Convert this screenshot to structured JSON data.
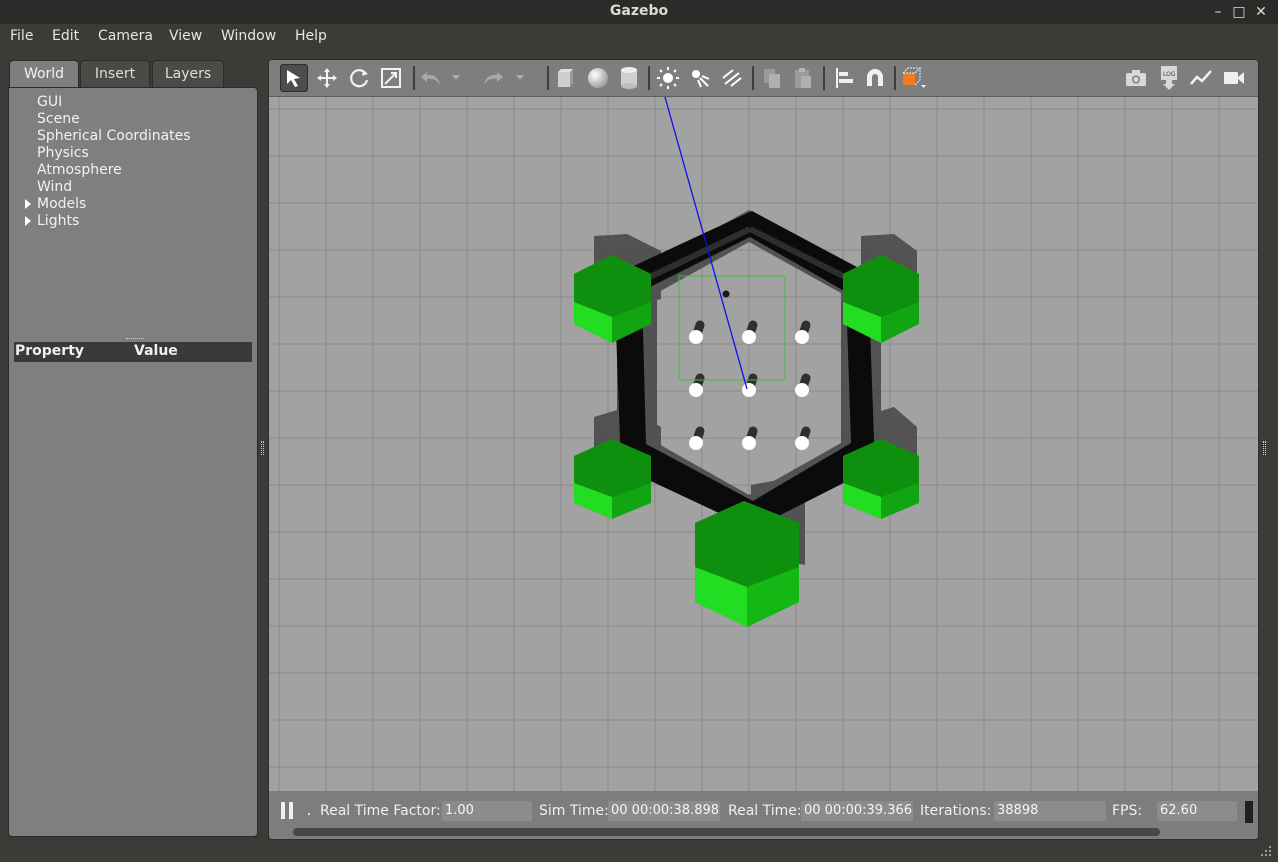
{
  "window": {
    "title": "Gazebo"
  },
  "menu": [
    "File",
    "Edit",
    "Camera",
    "View",
    "Window",
    "Help"
  ],
  "tabs": [
    "World",
    "Insert",
    "Layers"
  ],
  "tree": [
    "GUI",
    "Scene",
    "Spherical Coordinates",
    "Physics",
    "Atmosphere",
    "Wind",
    "Models",
    "Lights"
  ],
  "properties": {
    "col_property": "Property",
    "col_value": "Value"
  },
  "toolbar": {
    "icons": [
      "select-arrow-icon",
      "translate-icon",
      "rotate-icon",
      "scale-icon",
      "undo-icon",
      "redo-icon",
      "box-shape-icon",
      "sphere-shape-icon",
      "cylinder-shape-icon",
      "point-light-icon",
      "spot-light-icon",
      "directional-light-icon",
      "copy-icon",
      "paste-icon",
      "align-icon",
      "snap-magnet-icon",
      "view-angle-icon",
      "screenshot-camera-icon",
      "log-icon",
      "plot-icon",
      "video-record-icon"
    ]
  },
  "status": {
    "rtf_label": "Real Time Factor:",
    "rtf_value": "1.00",
    "sim_label": "Sim Time:",
    "sim_value": "00 00:00:38.898",
    "real_label": "Real Time:",
    "real_value": "00 00:00:39.366",
    "iter_label": "Iterations:",
    "iter_value": "38898",
    "fps_label": "FPS:",
    "fps_value": "62.60"
  },
  "colors": {
    "accent_green": "#22cc22",
    "ground": "#a2a2a2",
    "orange": "#f57a1f"
  }
}
